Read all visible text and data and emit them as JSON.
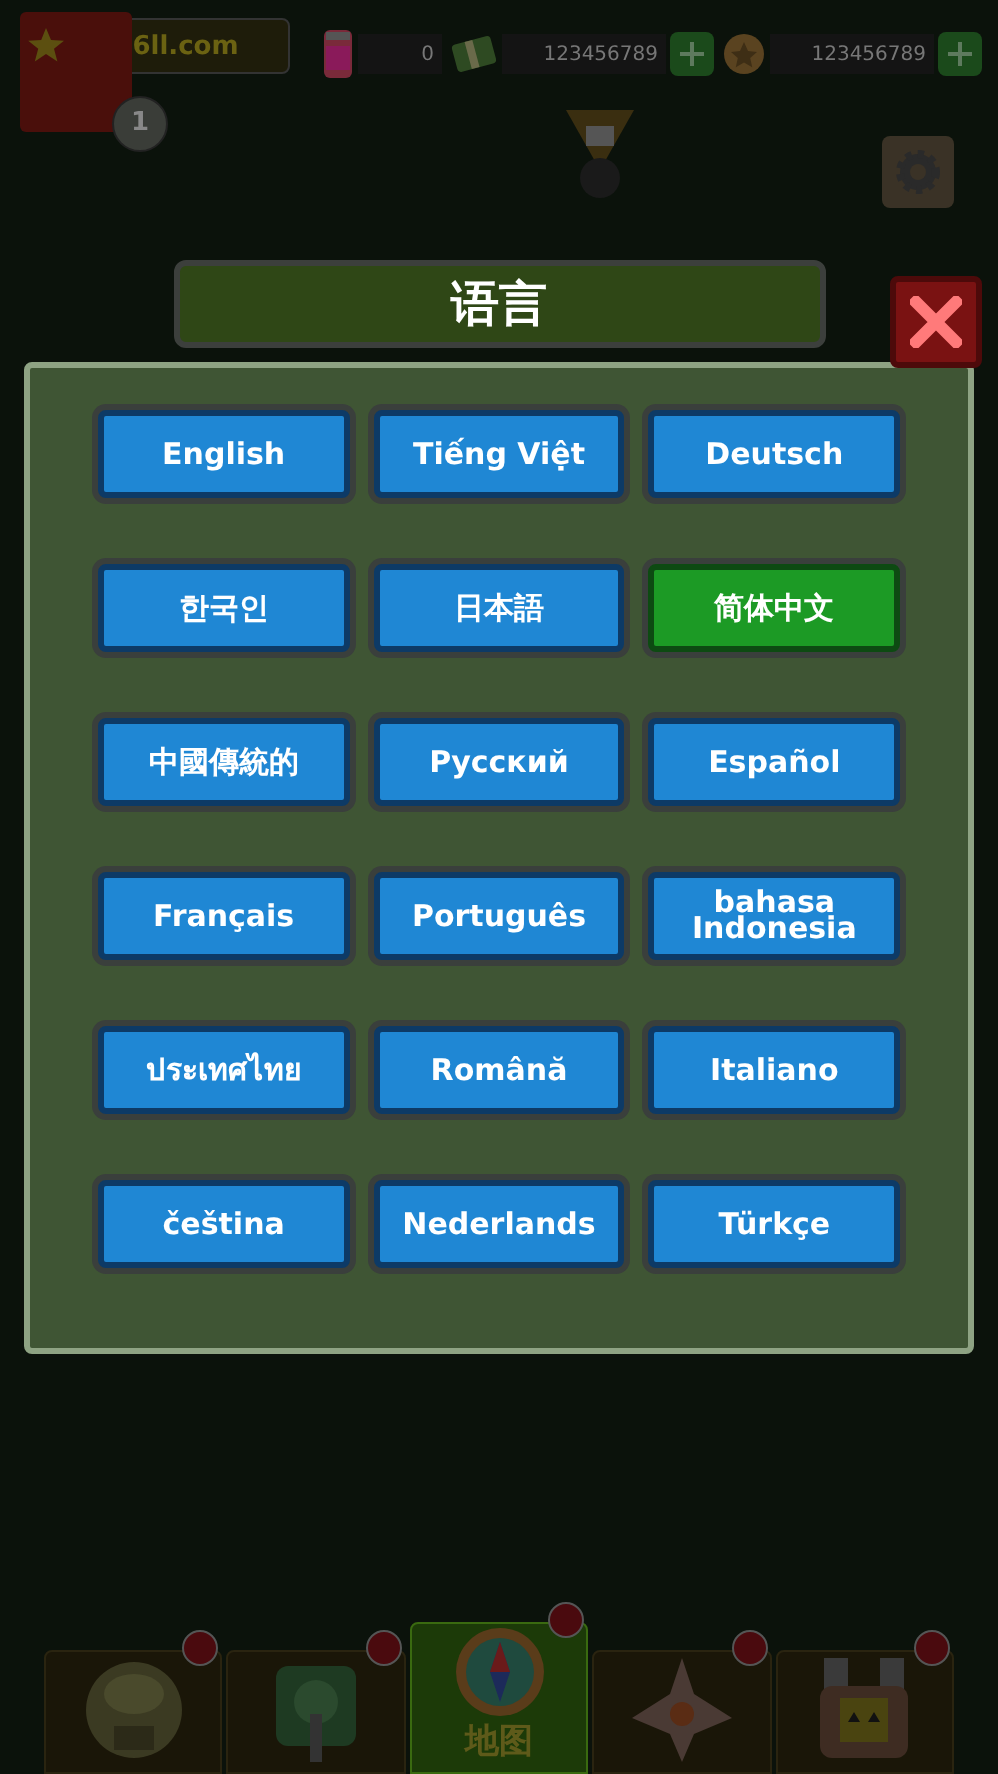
{
  "player": {
    "name": "6ll.com",
    "level": "1"
  },
  "currencies": [
    {
      "kind": "energy",
      "amount": "0",
      "addable": false
    },
    {
      "kind": "cash",
      "amount": "123456789",
      "addable": true
    },
    {
      "kind": "coin",
      "amount": "123456789",
      "addable": true
    }
  ],
  "dialog": {
    "title": "语言",
    "languages": [
      {
        "label": "English",
        "selected": false
      },
      {
        "label": "Tiếng Việt",
        "selected": false
      },
      {
        "label": "Deutsch",
        "selected": false
      },
      {
        "label": "한국인",
        "selected": false
      },
      {
        "label": "日本語",
        "selected": false
      },
      {
        "label": "简体中文",
        "selected": true
      },
      {
        "label": "中國傳統的",
        "selected": false
      },
      {
        "label": "Русский",
        "selected": false
      },
      {
        "label": "Español",
        "selected": false
      },
      {
        "label": "Français",
        "selected": false
      },
      {
        "label": "Português",
        "selected": false
      },
      {
        "label": "bahasa Indonesia",
        "selected": false
      },
      {
        "label": "ประเทศไทย",
        "selected": false
      },
      {
        "label": "Română",
        "selected": false
      },
      {
        "label": "Italiano",
        "selected": false
      },
      {
        "label": "čeština",
        "selected": false
      },
      {
        "label": "Nederlands",
        "selected": false
      },
      {
        "label": "Türkçe",
        "selected": false
      }
    ]
  },
  "nav": [
    {
      "kind": "base",
      "selected": false
    },
    {
      "kind": "tank",
      "selected": false
    },
    {
      "kind": "map",
      "label": "地图",
      "selected": true
    },
    {
      "kind": "ship",
      "selected": false
    },
    {
      "kind": "upgrade",
      "selected": false
    }
  ]
}
